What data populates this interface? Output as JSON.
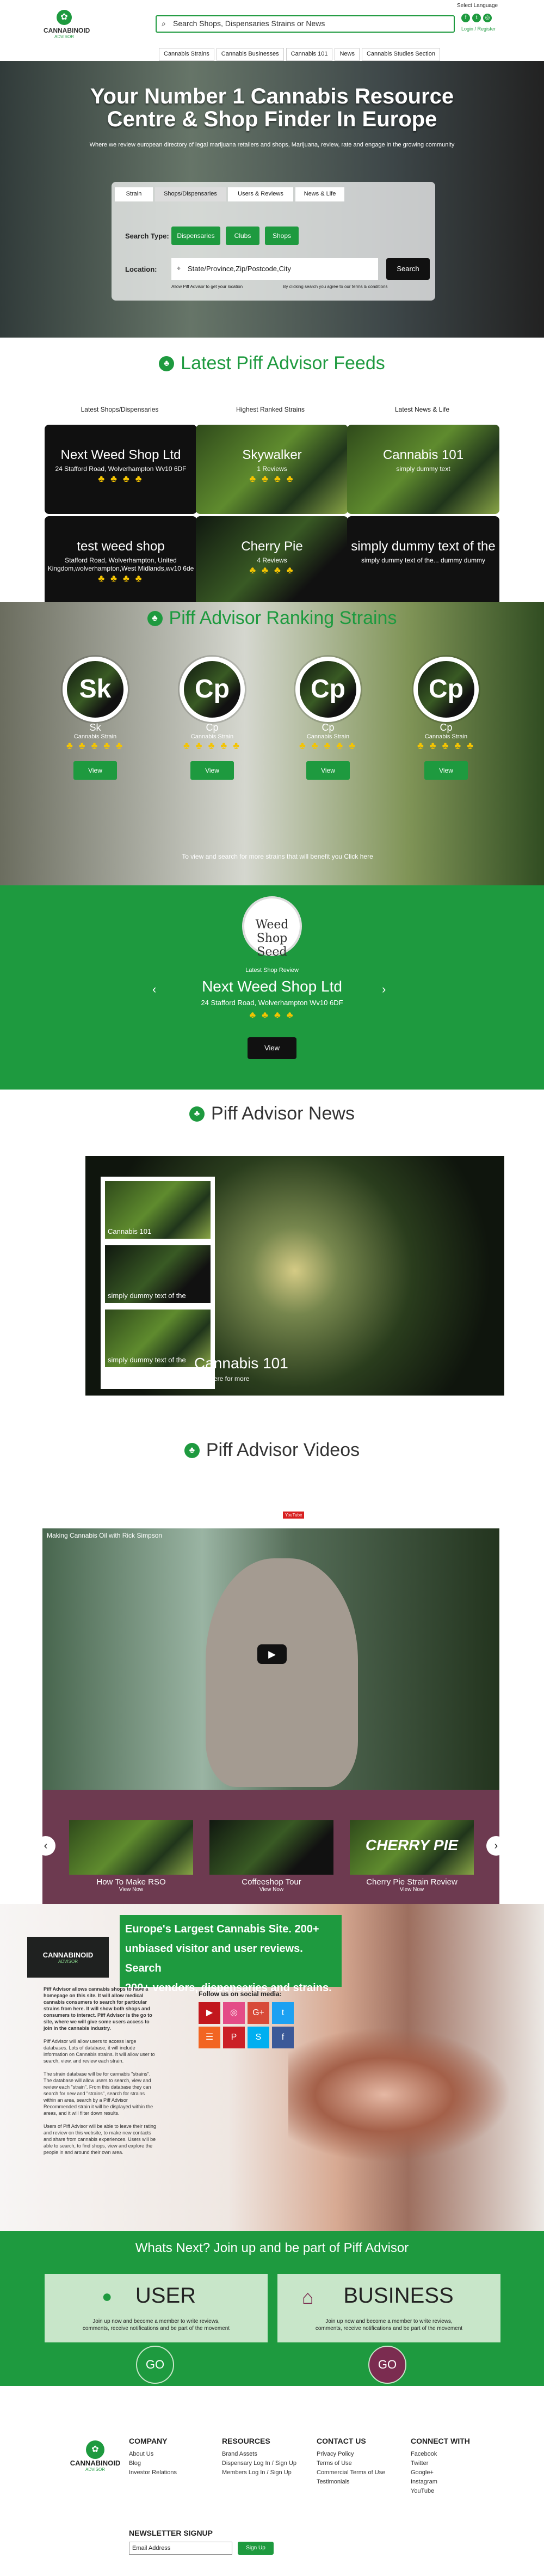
{
  "header": {
    "logo_top": "CANNABINOID",
    "logo_bottom": "ADVISOR",
    "search_placeholder": "Search Shops, Dispensaries Strains or News",
    "select_language": "Select Language",
    "login": "Login / Register"
  },
  "nav": [
    "Cannabis Strains",
    "Cannabis Businesses",
    "Cannabis 101",
    "News",
    "Cannabis Studies Section"
  ],
  "hero": {
    "title_line1": "Your Number 1 Cannabis Resource",
    "title_line2": "Centre & Shop Finder In Europe",
    "subtitle": "Where we review european directory of legal marijuana retailers and shops, Marijuana, review, rate and engage in the growing community",
    "tabs": [
      "Strain",
      "Shops/Dispensaries",
      "Users & Reviews",
      "News & Life"
    ],
    "search_type_label": "Search Type:",
    "search_types": [
      "Dispensaries",
      "Clubs",
      "Shops"
    ],
    "location_label": "Location:",
    "location_placeholder": "State/Province,Zip/Postcode,City",
    "search_button": "Search",
    "location_note": "Allow Piff Advisor to get your location",
    "terms_note": "By clicking search you agree to our terms & conditions"
  },
  "feeds": {
    "title": "Latest Piff Advisor Feeds",
    "columns": [
      "Latest Shops/Dispensaries",
      "Highest Ranked Strains",
      "Latest News & Life"
    ],
    "cards": [
      {
        "title": "Next Weed Shop Ltd",
        "sub": "24 Stafford Road, Wolverhampton Wv10 6DF",
        "stars": "♣ ♣ ♣ ♣"
      },
      {
        "title": "Skywalker",
        "sub": "1 Reviews",
        "stars": "♣ ♣ ♣ ♣"
      },
      {
        "title": "Cannabis 101",
        "sub": "simply dummy text",
        "stars": ""
      },
      {
        "title": "test weed shop",
        "sub": "Stafford Road, Wolverhampton, United Kingdom,wolverhampton,West Midlands,wv10 6de",
        "stars": "♣ ♣ ♣ ♣"
      },
      {
        "title": "Cherry Pie",
        "sub": "4 Reviews",
        "stars": "♣ ♣ ♣ ♣"
      },
      {
        "title": "simply dummy text of the",
        "sub": "simply dummy text of the... dummy dummy",
        "stars": ""
      }
    ]
  },
  "ranking": {
    "title": "Piff Advisor Ranking Strains",
    "strains": [
      {
        "abbr": "Sk",
        "name": "Sk",
        "type": "Cannabis Strain",
        "button": "View"
      },
      {
        "abbr": "Cp",
        "name": "Cp",
        "type": "Cannabis Strain",
        "button": "View"
      },
      {
        "abbr": "Cp",
        "name": "Cp",
        "type": "Cannabis Strain",
        "button": "View"
      },
      {
        "abbr": "Cp",
        "name": "Cp",
        "type": "Cannabis Strain",
        "button": "View"
      }
    ],
    "note": "To view and search for more strains that will benefit you Click here"
  },
  "featured": {
    "logo_text": "Weed Shop Seed",
    "label": "Latest Shop Review",
    "name": "Next Weed Shop Ltd",
    "address": "24 Stafford Road, Wolverhampton Wv10 6DF",
    "stars": "♣ ♣ ♣ ♣",
    "button": "View"
  },
  "news": {
    "title": "Piff Advisor News",
    "thumbs": [
      "Cannabis 101",
      "simply dummy text of the",
      "simply dummy text of the"
    ],
    "main_title": "Cannabis 101",
    "main_link": "Click here for more"
  },
  "videos": {
    "title": "Piff Advisor Videos",
    "youtube": "YouTube",
    "video_title": "Making Cannabis Oil with Rick Simpson",
    "items": [
      {
        "title": "How To Make RSO",
        "link": "View Now"
      },
      {
        "title": "Coffeeshop Tour",
        "link": "View Now"
      },
      {
        "title": "Cherry Pie Strain Review",
        "link": "View Now"
      }
    ],
    "cherry_overlay": "CHERRY PIE"
  },
  "about": {
    "logo_top": "CANNABINOID",
    "logo_bottom": "ADVISOR",
    "banner_line1": "Europe's Largest Cannabis Site. 200+",
    "banner_line2": "unbiased visitor and user reviews. Search",
    "banner_line3": "200+ vendors, dispensaries and strains.",
    "p1": "Piff Advisor allows cannabis shops to have a homepage on this site. It will allow medical cannabis consumers to search for particular strains from here. It will show both shops and consumers to interact. Piff Advisor is the go to site, where we will give some users access to join in the cannabis industry.",
    "p2": "Piff Advisor will allow users to access large databases. Lots of database, it will include information on Cannabis strains. It will allow user to search, view, and review each strain.",
    "p3": "The strain database will be for cannabis \"strains\". The database will allow users to search, view and review each \"strain\". From this database they can search for new and \"strains\", search for strains within an area, search by a Piff Advisor Recommended strain it will be displayed within the areas, and it will filter down results.",
    "p4": "Users of Piff Advisor will be able to leave their rating and review on this website, to make new contacts and share from cannabis experiences. Users will be able to search, to find shops, view and explore the people in and around their own area.",
    "social_title": "Follow us on social media:"
  },
  "join": {
    "title": "Whats Next? Join up and be part of Piff Advisor",
    "user_title": "USER",
    "user_text": "Join up now and become a member to write reviews, comments, receive notifications and be part of the movement",
    "business_title": "BUSINESS",
    "business_text": "Join up now and become a member to write reviews, comments, receive notifications and be part of the movement",
    "go": "GO"
  },
  "footer": {
    "logo_top": "CANNABINOID",
    "logo_bottom": "ADVISOR",
    "company": "COMPANY",
    "company_links": [
      "About Us",
      "Blog",
      "Investor Relations"
    ],
    "resources": "RESOURCES",
    "resource_links": [
      "Brand Assets",
      "Dispensary Log In / Sign Up",
      "Members Log In / Sign Up"
    ],
    "contact": "CONTACT US",
    "contact_links": [
      "Privacy Policy",
      "Terms of Use",
      "Commercial Terms of Use",
      "Testimonials"
    ],
    "connect": "CONNECT WITH",
    "connect_links": [
      "Facebook",
      "Twitter",
      "Google+",
      "Instagram",
      "YouTube"
    ],
    "newsletter": "NEWSLETTER SIGNUP",
    "email_placeholder": "Email Address",
    "signup": "Sign Up"
  }
}
